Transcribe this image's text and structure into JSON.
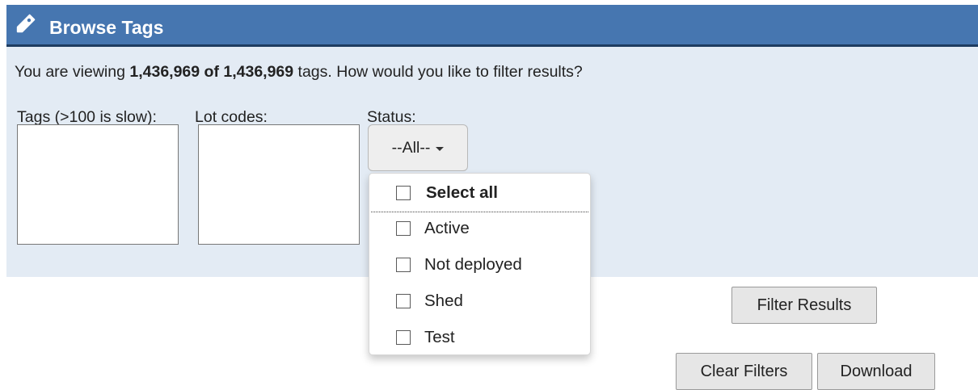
{
  "header": {
    "title": "Browse Tags",
    "icon": "tag-icon",
    "colors": {
      "bar": "#4676b0",
      "border": "#1e3c60",
      "panel": "#e3ebf4"
    }
  },
  "summary": {
    "prefix": "You are viewing ",
    "count": "1,436,969 of 1,436,969",
    "suffix": " tags. How would you like to filter results?"
  },
  "filters": {
    "tags_label": "Tags (>100 is slow):",
    "lot_codes_label": "Lot codes:",
    "status_label": "Status:",
    "status_selected": "--All--"
  },
  "status_dropdown": {
    "select_all": "Select all",
    "options": [
      "Active",
      "Not deployed",
      "Shed",
      "Test"
    ]
  },
  "buttons": {
    "filter_results": "Filter Results",
    "clear_filters": "Clear Filters",
    "download": "Download"
  }
}
